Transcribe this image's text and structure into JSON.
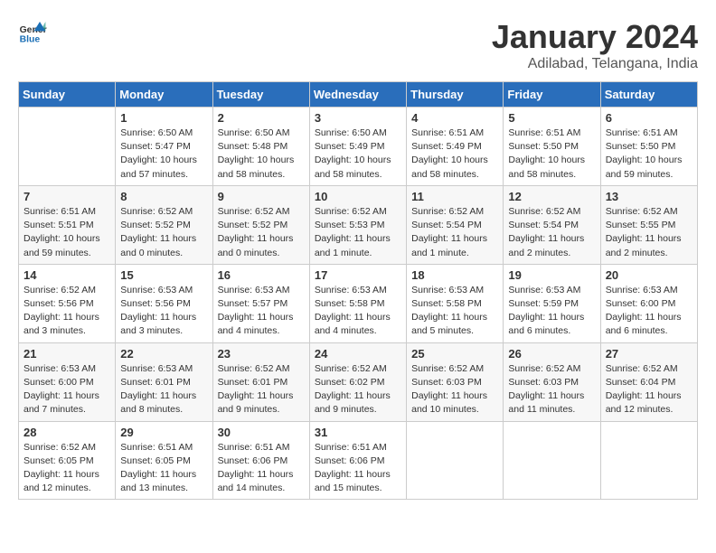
{
  "header": {
    "logo_line1": "General",
    "logo_line2": "Blue",
    "month": "January 2024",
    "location": "Adilabad, Telangana, India"
  },
  "weekdays": [
    "Sunday",
    "Monday",
    "Tuesday",
    "Wednesday",
    "Thursday",
    "Friday",
    "Saturday"
  ],
  "weeks": [
    [
      {
        "day": "",
        "sunrise": "",
        "sunset": "",
        "daylight": ""
      },
      {
        "day": "1",
        "sunrise": "Sunrise: 6:50 AM",
        "sunset": "Sunset: 5:47 PM",
        "daylight": "Daylight: 10 hours and 57 minutes."
      },
      {
        "day": "2",
        "sunrise": "Sunrise: 6:50 AM",
        "sunset": "Sunset: 5:48 PM",
        "daylight": "Daylight: 10 hours and 58 minutes."
      },
      {
        "day": "3",
        "sunrise": "Sunrise: 6:50 AM",
        "sunset": "Sunset: 5:49 PM",
        "daylight": "Daylight: 10 hours and 58 minutes."
      },
      {
        "day": "4",
        "sunrise": "Sunrise: 6:51 AM",
        "sunset": "Sunset: 5:49 PM",
        "daylight": "Daylight: 10 hours and 58 minutes."
      },
      {
        "day": "5",
        "sunrise": "Sunrise: 6:51 AM",
        "sunset": "Sunset: 5:50 PM",
        "daylight": "Daylight: 10 hours and 58 minutes."
      },
      {
        "day": "6",
        "sunrise": "Sunrise: 6:51 AM",
        "sunset": "Sunset: 5:50 PM",
        "daylight": "Daylight: 10 hours and 59 minutes."
      }
    ],
    [
      {
        "day": "7",
        "sunrise": "Sunrise: 6:51 AM",
        "sunset": "Sunset: 5:51 PM",
        "daylight": "Daylight: 10 hours and 59 minutes."
      },
      {
        "day": "8",
        "sunrise": "Sunrise: 6:52 AM",
        "sunset": "Sunset: 5:52 PM",
        "daylight": "Daylight: 11 hours and 0 minutes."
      },
      {
        "day": "9",
        "sunrise": "Sunrise: 6:52 AM",
        "sunset": "Sunset: 5:52 PM",
        "daylight": "Daylight: 11 hours and 0 minutes."
      },
      {
        "day": "10",
        "sunrise": "Sunrise: 6:52 AM",
        "sunset": "Sunset: 5:53 PM",
        "daylight": "Daylight: 11 hours and 1 minute."
      },
      {
        "day": "11",
        "sunrise": "Sunrise: 6:52 AM",
        "sunset": "Sunset: 5:54 PM",
        "daylight": "Daylight: 11 hours and 1 minute."
      },
      {
        "day": "12",
        "sunrise": "Sunrise: 6:52 AM",
        "sunset": "Sunset: 5:54 PM",
        "daylight": "Daylight: 11 hours and 2 minutes."
      },
      {
        "day": "13",
        "sunrise": "Sunrise: 6:52 AM",
        "sunset": "Sunset: 5:55 PM",
        "daylight": "Daylight: 11 hours and 2 minutes."
      }
    ],
    [
      {
        "day": "14",
        "sunrise": "Sunrise: 6:52 AM",
        "sunset": "Sunset: 5:56 PM",
        "daylight": "Daylight: 11 hours and 3 minutes."
      },
      {
        "day": "15",
        "sunrise": "Sunrise: 6:53 AM",
        "sunset": "Sunset: 5:56 PM",
        "daylight": "Daylight: 11 hours and 3 minutes."
      },
      {
        "day": "16",
        "sunrise": "Sunrise: 6:53 AM",
        "sunset": "Sunset: 5:57 PM",
        "daylight": "Daylight: 11 hours and 4 minutes."
      },
      {
        "day": "17",
        "sunrise": "Sunrise: 6:53 AM",
        "sunset": "Sunset: 5:58 PM",
        "daylight": "Daylight: 11 hours and 4 minutes."
      },
      {
        "day": "18",
        "sunrise": "Sunrise: 6:53 AM",
        "sunset": "Sunset: 5:58 PM",
        "daylight": "Daylight: 11 hours and 5 minutes."
      },
      {
        "day": "19",
        "sunrise": "Sunrise: 6:53 AM",
        "sunset": "Sunset: 5:59 PM",
        "daylight": "Daylight: 11 hours and 6 minutes."
      },
      {
        "day": "20",
        "sunrise": "Sunrise: 6:53 AM",
        "sunset": "Sunset: 6:00 PM",
        "daylight": "Daylight: 11 hours and 6 minutes."
      }
    ],
    [
      {
        "day": "21",
        "sunrise": "Sunrise: 6:53 AM",
        "sunset": "Sunset: 6:00 PM",
        "daylight": "Daylight: 11 hours and 7 minutes."
      },
      {
        "day": "22",
        "sunrise": "Sunrise: 6:53 AM",
        "sunset": "Sunset: 6:01 PM",
        "daylight": "Daylight: 11 hours and 8 minutes."
      },
      {
        "day": "23",
        "sunrise": "Sunrise: 6:52 AM",
        "sunset": "Sunset: 6:01 PM",
        "daylight": "Daylight: 11 hours and 9 minutes."
      },
      {
        "day": "24",
        "sunrise": "Sunrise: 6:52 AM",
        "sunset": "Sunset: 6:02 PM",
        "daylight": "Daylight: 11 hours and 9 minutes."
      },
      {
        "day": "25",
        "sunrise": "Sunrise: 6:52 AM",
        "sunset": "Sunset: 6:03 PM",
        "daylight": "Daylight: 11 hours and 10 minutes."
      },
      {
        "day": "26",
        "sunrise": "Sunrise: 6:52 AM",
        "sunset": "Sunset: 6:03 PM",
        "daylight": "Daylight: 11 hours and 11 minutes."
      },
      {
        "day": "27",
        "sunrise": "Sunrise: 6:52 AM",
        "sunset": "Sunset: 6:04 PM",
        "daylight": "Daylight: 11 hours and 12 minutes."
      }
    ],
    [
      {
        "day": "28",
        "sunrise": "Sunrise: 6:52 AM",
        "sunset": "Sunset: 6:05 PM",
        "daylight": "Daylight: 11 hours and 12 minutes."
      },
      {
        "day": "29",
        "sunrise": "Sunrise: 6:51 AM",
        "sunset": "Sunset: 6:05 PM",
        "daylight": "Daylight: 11 hours and 13 minutes."
      },
      {
        "day": "30",
        "sunrise": "Sunrise: 6:51 AM",
        "sunset": "Sunset: 6:06 PM",
        "daylight": "Daylight: 11 hours and 14 minutes."
      },
      {
        "day": "31",
        "sunrise": "Sunrise: 6:51 AM",
        "sunset": "Sunset: 6:06 PM",
        "daylight": "Daylight: 11 hours and 15 minutes."
      },
      {
        "day": "",
        "sunrise": "",
        "sunset": "",
        "daylight": ""
      },
      {
        "day": "",
        "sunrise": "",
        "sunset": "",
        "daylight": ""
      },
      {
        "day": "",
        "sunrise": "",
        "sunset": "",
        "daylight": ""
      }
    ]
  ]
}
